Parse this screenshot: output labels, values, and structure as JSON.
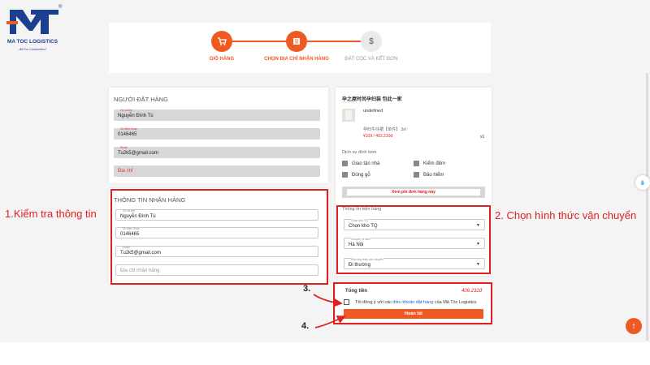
{
  "logo": {
    "brand": "MA TOC LOGISTICS",
    "tagline": "All For Customers!",
    "reg": "®"
  },
  "steps": [
    {
      "label": "GIỎ HÀNG",
      "icon": "cart-icon",
      "state": "active"
    },
    {
      "label": "CHỌN ĐỊA CHỈ NHẬN HÀNG",
      "icon": "map-icon",
      "state": "active"
    },
    {
      "label": "ĐẶT CỌC VÀ KẾT ĐƠN",
      "icon": "dollar-icon",
      "state": "inactive"
    }
  ],
  "orderer": {
    "title": "NGƯỜI ĐẶT HÀNG",
    "name_label": "Họ và tên",
    "name_value": "Nguyễn Đình Tú",
    "phone_label": "Số điện thoại",
    "phone_value": "0146465",
    "email_label": "Email",
    "email_value": "Tu2k5@gmail.com",
    "address_placeholder": "Địa chỉ"
  },
  "receiver": {
    "title": "THÔNG TIN NHẬN HÀNG",
    "name_label": "Họ và tên",
    "name_value": "Nguyễn Đình Tú",
    "phone_label": "Số điện thoại",
    "phone_value": "0146465",
    "email_label": "Email",
    "email_value": "Tu2k5@gmail.com",
    "address_placeholder": "Địa chỉ nhận hàng"
  },
  "product": {
    "shop": "孕之屋时尚孕妇装 包此一家",
    "name": "undefined",
    "variant": "孕妇牛仔裙【单件】 3xl",
    "price": "¥109 / 402.210đ",
    "qty": "x1"
  },
  "services": {
    "title": "Dịch vụ đính kèm",
    "items": [
      "Giao tận nhà",
      "Kiểm đếm",
      "Đóng gỗ",
      "Bảo hiểm"
    ],
    "fee_link": "Xem phí đơn hàng này"
  },
  "shipping": {
    "title": "Thông tin kiện hàng",
    "warehouse_label": "Chọn kho TQ",
    "warehouse_value": "Chọn kho TQ",
    "destination_label": "Chuyển về kho",
    "destination_value": "Hà Nội",
    "method_label": "Phương thức vận chuyển",
    "method_value": "Đi thường"
  },
  "summary": {
    "total_label": "Tổng tiền",
    "total_value": "406.232đ",
    "terms_prefix": "Tôi đồng ý với các",
    "terms_link": "điều khoản đặt hàng",
    "terms_suffix": "của Mã Tóc Logistics",
    "submit_label": "Hoàn tất"
  },
  "annotations": {
    "left": "1.Kiểm tra thông tin",
    "right": "2. Chọn hình thức vận chuyển",
    "num3": "3.",
    "num4": "4."
  },
  "side_chip": "💧",
  "colors": {
    "accent": "#ef5a22",
    "annotation": "#e02020",
    "brand": "#1d3f8f"
  }
}
